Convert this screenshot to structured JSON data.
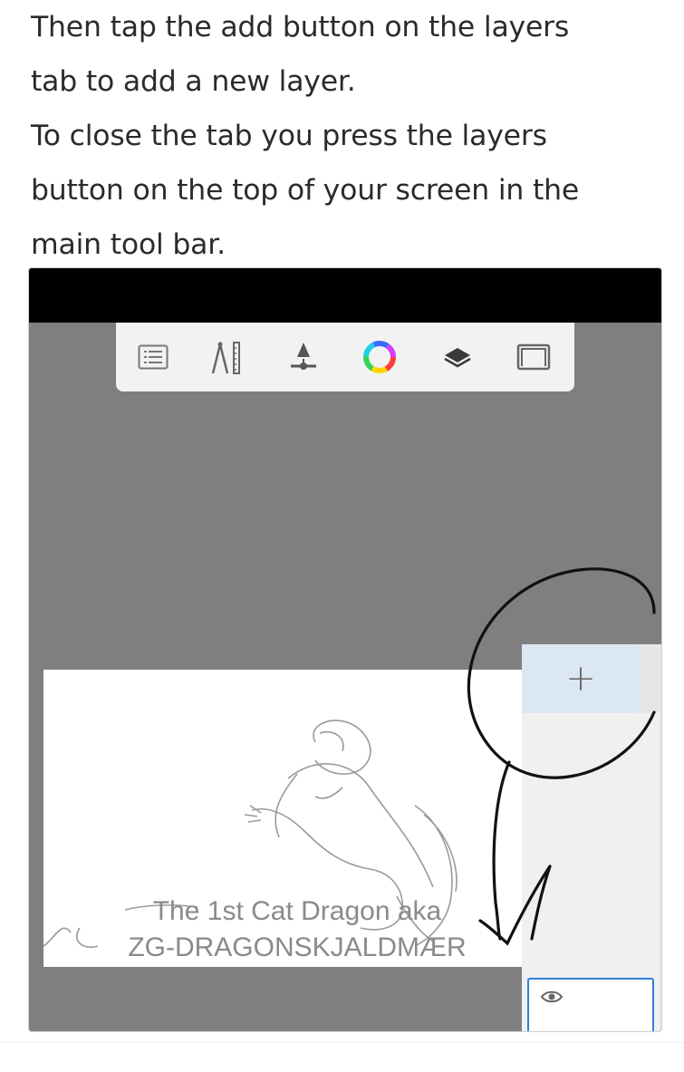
{
  "instructions": {
    "line1": "Then tap the add button on the layers",
    "line2": "tab to add a new layer.",
    "line3": "To close the tab you press the layers",
    "line4": "button on the top of your screen in the",
    "line5": "main tool bar."
  },
  "screenshot": {
    "toolbar": {
      "tools": [
        {
          "icon": "list-icon"
        },
        {
          "icon": "ruler-tools-icon"
        },
        {
          "icon": "brush-size-icon"
        },
        {
          "icon": "color-wheel-icon"
        },
        {
          "icon": "layers-icon"
        },
        {
          "icon": "fullscreen-icon"
        }
      ]
    },
    "canvas": {
      "watermark_line1": "The 1st Cat Dragon aka",
      "watermark_line2": "ZG-DRAGONSKJALDMÆR"
    },
    "layers_panel": {
      "add_label": "+",
      "layer_visibility_icon": "eye-icon"
    }
  },
  "colors": {
    "toolbar_bg": "#f2f2f2",
    "workspace_bg": "#7f7f7f",
    "add_row_bg": "#dbe7f3",
    "selected_layer_border": "#2f80d6"
  }
}
